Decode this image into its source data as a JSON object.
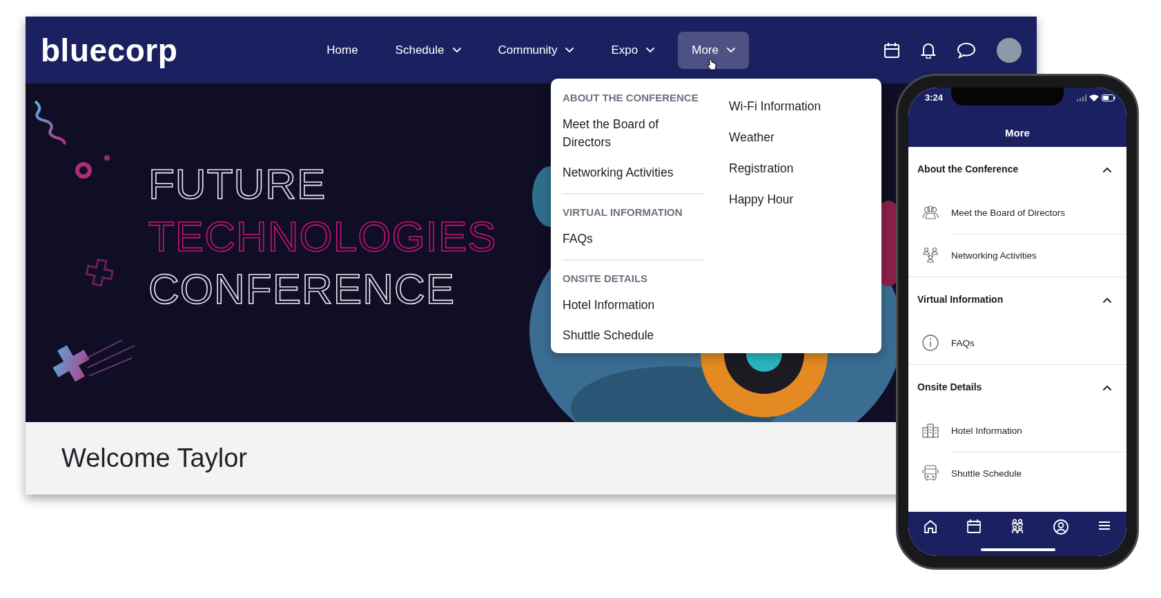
{
  "web": {
    "logo": "bluecorp",
    "nav": [
      {
        "label": "Home",
        "dropdown": false,
        "selected": false
      },
      {
        "label": "Schedule",
        "dropdown": true,
        "selected": false
      },
      {
        "label": "Community",
        "dropdown": true,
        "selected": false
      },
      {
        "label": "Expo",
        "dropdown": true,
        "selected": false
      },
      {
        "label": "More",
        "dropdown": true,
        "selected": true
      }
    ],
    "hero": {
      "lines": [
        {
          "text": "FUTURE",
          "highlighted": false
        },
        {
          "text": "TECHNOLOGIES",
          "highlighted": true
        },
        {
          "text": "CONFERENCE",
          "highlighted": false
        }
      ]
    },
    "welcome": "Welcome Taylor",
    "dropdown": {
      "groups": [
        {
          "heading": "ABOUT THE CONFERENCE",
          "items": [
            "Meet the Board of Directors",
            "Networking Activities"
          ]
        },
        {
          "heading": "VIRTUAL INFORMATION",
          "items": [
            "FAQs"
          ]
        },
        {
          "heading": "ONSITE DETAILS",
          "items": [
            "Hotel Information",
            "Shuttle Schedule"
          ]
        }
      ],
      "more_items": [
        "Wi-Fi Information",
        "Weather",
        "Registration",
        "Happy Hour"
      ]
    }
  },
  "phone": {
    "time": "3:24",
    "title": "More",
    "sections": [
      {
        "title": "About the Conference",
        "expanded": true,
        "items": [
          "Meet the Board of Directors",
          "Networking Activities"
        ]
      },
      {
        "title": "Virtual Information",
        "expanded": true,
        "items": [
          "FAQs"
        ]
      },
      {
        "title": "Onsite Details",
        "expanded": true,
        "items": [
          "Hotel Information",
          "Shuttle Schedule"
        ]
      }
    ]
  }
}
